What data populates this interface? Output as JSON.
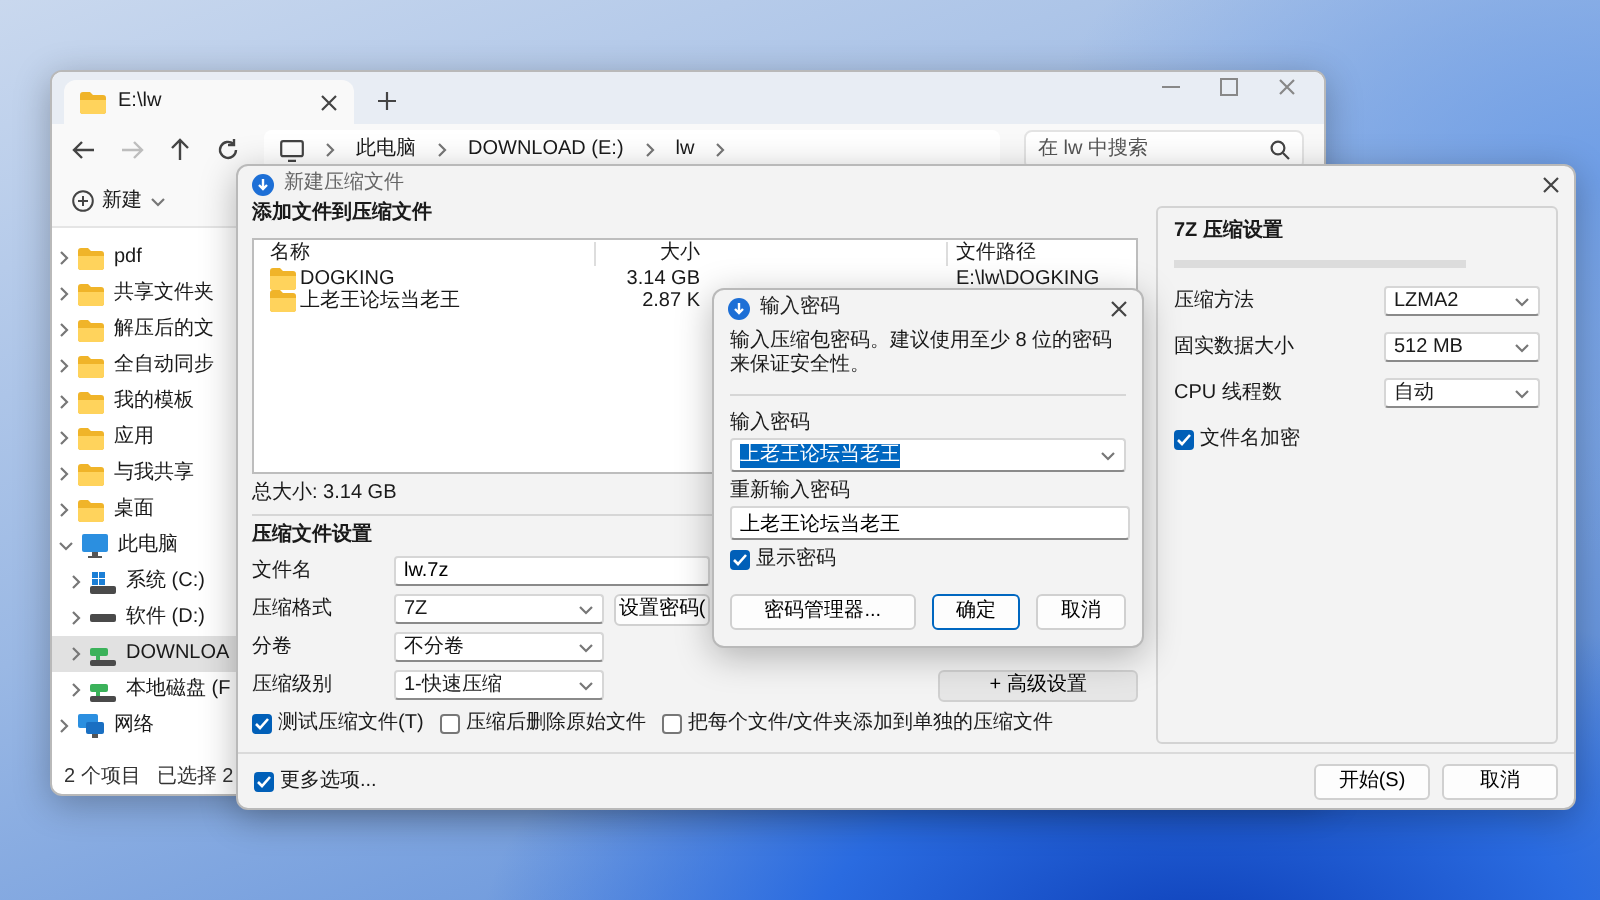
{
  "explorer": {
    "tab": {
      "title": "E:\\lw"
    },
    "nav_buttons": [
      {
        "kind": "back",
        "disabled": false
      },
      {
        "kind": "forward",
        "disabled": true
      },
      {
        "kind": "up",
        "disabled": false
      },
      {
        "kind": "refresh",
        "disabled": false
      }
    ],
    "breadcrumb": [
      "此电脑",
      "DOWNLOAD (E:)",
      "lw"
    ],
    "search": {
      "placeholder": "在 lw 中搜索"
    },
    "toolbar": {
      "new_label": "新建"
    },
    "sidebar": {
      "items": [
        {
          "label": "pdf",
          "kind": "folder",
          "expanded": false,
          "selected": false
        },
        {
          "label": "共享文件夹",
          "kind": "folder",
          "expanded": false,
          "selected": false
        },
        {
          "label": "解压后的文",
          "kind": "folder",
          "expanded": false,
          "selected": false
        },
        {
          "label": "全自动同步",
          "kind": "folder",
          "expanded": false,
          "selected": false
        },
        {
          "label": "我的模板",
          "kind": "folder",
          "expanded": false,
          "selected": false
        },
        {
          "label": "应用",
          "kind": "folder",
          "expanded": false,
          "selected": false
        },
        {
          "label": "与我共享",
          "kind": "folder",
          "expanded": false,
          "selected": false
        },
        {
          "label": "桌面",
          "kind": "folder",
          "expanded": false,
          "selected": false
        },
        {
          "label": "此电脑",
          "kind": "pc",
          "expanded": true,
          "selected": false,
          "children": [
            {
              "label": "系统 (C:)",
              "kind": "system_drive",
              "expanded": false,
              "selected": false
            },
            {
              "label": "软件 (D:)",
              "kind": "drive",
              "expanded": false,
              "selected": false
            },
            {
              "label": "DOWNLOA",
              "kind": "mapped_drive",
              "expanded": false,
              "selected": true
            },
            {
              "label": "本地磁盘 (F",
              "kind": "mapped_drive",
              "expanded": false,
              "selected": false
            }
          ]
        },
        {
          "label": "网络",
          "kind": "network",
          "expanded": false,
          "selected": false
        }
      ]
    },
    "status_bar": {
      "item_count": "2 个项目",
      "selection": "已选择 2"
    }
  },
  "compress_dialog": {
    "title": "新建压缩文件",
    "files_heading": "添加文件到压缩文件",
    "file_table": {
      "columns": [
        "名称",
        "大小",
        "文件路径"
      ],
      "rows": [
        {
          "name": "DOGKING",
          "size": "3.14 GB",
          "path": "E:\\lw\\DOGKING"
        },
        {
          "name": "上老王论坛当老王",
          "size": "2.87 K"
        }
      ]
    },
    "total_size": "总大小: 3.14 GB",
    "settings_heading": "压缩文件设置",
    "fields": [
      {
        "label": "文件名",
        "kind": "text",
        "value": "lw.7z"
      },
      {
        "label": "压缩格式",
        "kind": "select",
        "value": "7Z"
      },
      {
        "label": "分卷",
        "kind": "select",
        "value": "不分卷"
      },
      {
        "label": "压缩级别",
        "kind": "select",
        "value": "1-快速压缩"
      }
    ],
    "set_password_button": "设置密码(",
    "advanced_button": "+ 高级设置",
    "options": [
      {
        "label": "测试压缩文件(T)",
        "checked": true
      },
      {
        "label": "压缩后删除原始文件",
        "checked": false
      },
      {
        "label": "把每个文件/文件夹添加到单独的压缩文件",
        "checked": false
      }
    ],
    "more_options": {
      "label": "更多选项...",
      "checked": true
    },
    "buttons": [
      "开始(S)",
      "取消"
    ],
    "format_panel": {
      "title": "7Z 压缩设置",
      "fields": [
        {
          "label": "压缩方法",
          "value": "LZMA2"
        },
        {
          "label": "固实数据大小",
          "value": "512 MB"
        },
        {
          "label": "CPU 线程数",
          "value": "自动"
        }
      ],
      "encrypt_names": {
        "label": "文件名加密",
        "checked": true
      }
    }
  },
  "password_dialog": {
    "title": "输入密码",
    "message": "输入压缩包密码。建议使用至少 8 位的密码来保证安全性。",
    "password": {
      "label": "输入密码",
      "value": "上老王论坛当老王",
      "text_selected": true
    },
    "confirm": {
      "label": "重新输入密码",
      "value": "上老王论坛当老王"
    },
    "show_password": {
      "label": "显示密码",
      "checked": true
    },
    "buttons": [
      {
        "label": "密码管理器...",
        "default": false
      },
      {
        "label": "确定",
        "default": true
      },
      {
        "label": "取消",
        "default": false
      }
    ]
  }
}
